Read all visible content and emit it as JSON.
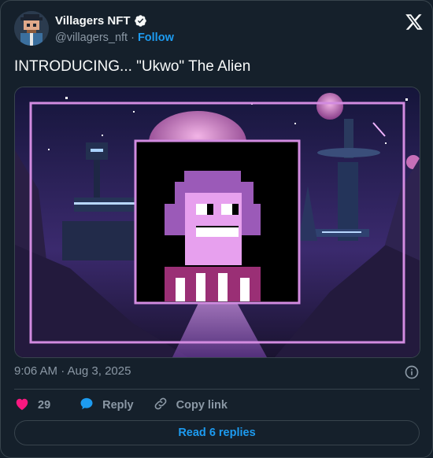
{
  "author": {
    "name": "Villagers NFT",
    "handle": "@villagers_nft",
    "follow_label": "Follow",
    "verified": true
  },
  "tweet": {
    "text": "INTRODUCING... \"Ukwo\" The Alien",
    "timestamp": "9:06 AM · Aug 3, 2025"
  },
  "actions": {
    "like_count": "29",
    "reply_label": "Reply",
    "copy_link_label": "Copy link"
  },
  "read_replies_label": "Read 6 replies",
  "icons": {
    "brand": "x-logo",
    "like": "heart-icon",
    "reply": "reply-bubble-icon",
    "copy": "link-icon",
    "info": "info-icon",
    "verified": "verified-badge-icon"
  },
  "colors": {
    "background": "#15202b",
    "border": "#38444d",
    "text_primary": "#f7f9f9",
    "text_secondary": "#8b98a5",
    "accent_blue": "#1d9bf0",
    "like_pink": "#f91880"
  }
}
